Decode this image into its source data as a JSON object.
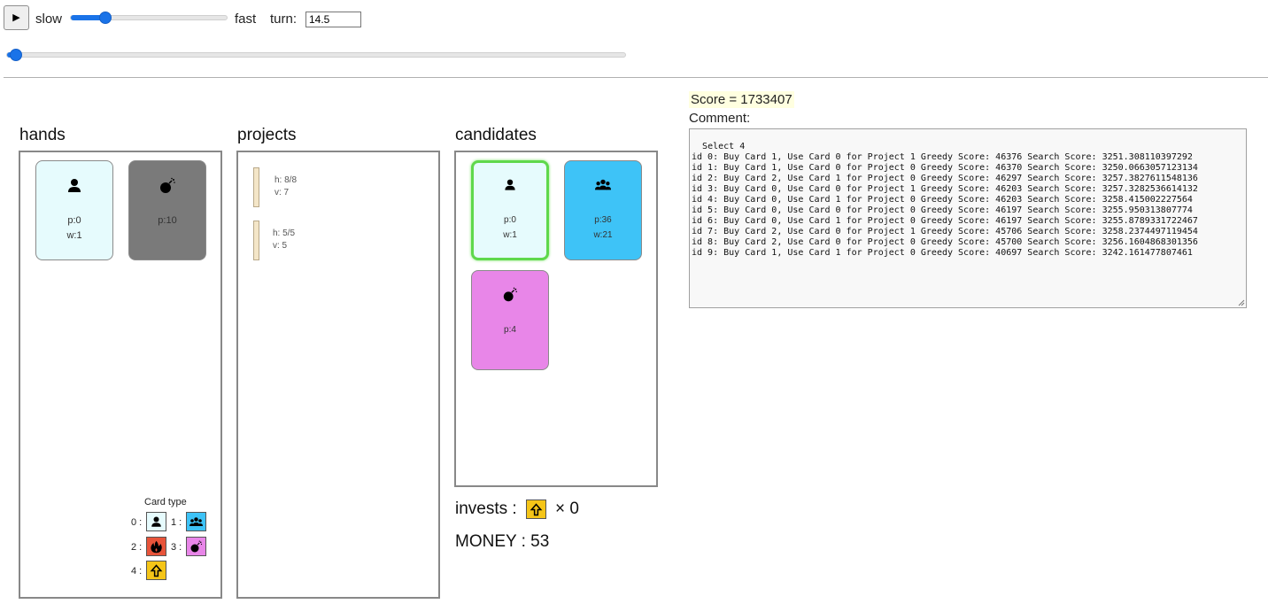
{
  "controls": {
    "play_label": "▶",
    "slow_label": "slow",
    "fast_label": "fast",
    "turn_label": "turn:",
    "turn_value": "14.5",
    "speed_level": 0.22,
    "turn_progress": 0.015
  },
  "hands": {
    "title": "hands",
    "cards": [
      {
        "type": 0,
        "icon": "person-icon",
        "p": "p:0",
        "w": "w:1",
        "color": "#e6fbfd"
      },
      {
        "type": 3,
        "icon": "bomb-icon",
        "p": "p:10",
        "w": "",
        "color": "#7a7a7a"
      }
    ],
    "legend": {
      "title": "Card type",
      "items": [
        {
          "num": "0 :",
          "icon": "person-icon",
          "color": "#e6fbfd"
        },
        {
          "num": "1 :",
          "icon": "group-icon",
          "color": "#3ec3f7"
        },
        {
          "num": "2 :",
          "icon": "fire-icon",
          "color": "#e8543a"
        },
        {
          "num": "3 :",
          "icon": "bomb-icon",
          "color": "#e886e8"
        },
        {
          "num": "4 :",
          "icon": "arrow-up-icon",
          "color": "#f5c518"
        }
      ]
    }
  },
  "projects": {
    "title": "projects",
    "items": [
      {
        "h": "h: 8/8",
        "v": "v: 7",
        "progress": 1.0
      },
      {
        "h": "h: 5/5",
        "v": "v: 5",
        "progress": 1.0
      }
    ]
  },
  "candidates": {
    "title": "candidates",
    "cards": [
      {
        "type": 0,
        "icon": "person-icon",
        "p": "p:0",
        "w": "w:1",
        "color": "#e6fbfd",
        "selected": true
      },
      {
        "type": 1,
        "icon": "group-icon",
        "p": "p:36",
        "w": "w:21",
        "color": "#3ec3f7",
        "selected": false
      },
      {
        "type": 3,
        "icon": "bomb-icon",
        "p": "p:4",
        "w": "",
        "color": "#e886e8",
        "selected": false
      }
    ],
    "invests_label": "invests :",
    "invests_count": "× 0",
    "money": "MONEY : 53"
  },
  "score": "Score = 1733407",
  "comment_label": "Comment:",
  "comment_text": "Select 4\nid 0: Buy Card 1, Use Card 0 for Project 1 Greedy Score: 46376 Search Score: 3251.308110397292\nid 1: Buy Card 1, Use Card 0 for Project 0 Greedy Score: 46370 Search Score: 3250.0663057123134\nid 2: Buy Card 2, Use Card 1 for Project 0 Greedy Score: 46297 Search Score: 3257.3827611548136\nid 3: Buy Card 0, Use Card 0 for Project 1 Greedy Score: 46203 Search Score: 3257.3282536614132\nid 4: Buy Card 0, Use Card 1 for Project 0 Greedy Score: 46203 Search Score: 3258.415002227564\nid 5: Buy Card 0, Use Card 0 for Project 0 Greedy Score: 46197 Search Score: 3255.950313807774\nid 6: Buy Card 0, Use Card 1 for Project 0 Greedy Score: 46197 Search Score: 3255.8789331722467\nid 7: Buy Card 2, Use Card 0 for Project 1 Greedy Score: 45706 Search Score: 3258.2374497119454\nid 8: Buy Card 2, Use Card 0 for Project 0 Greedy Score: 45700 Search Score: 3256.1604868301356\nid 9: Buy Card 1, Use Card 1 for Project 0 Greedy Score: 40697 Search Score: 3242.161477807461"
}
